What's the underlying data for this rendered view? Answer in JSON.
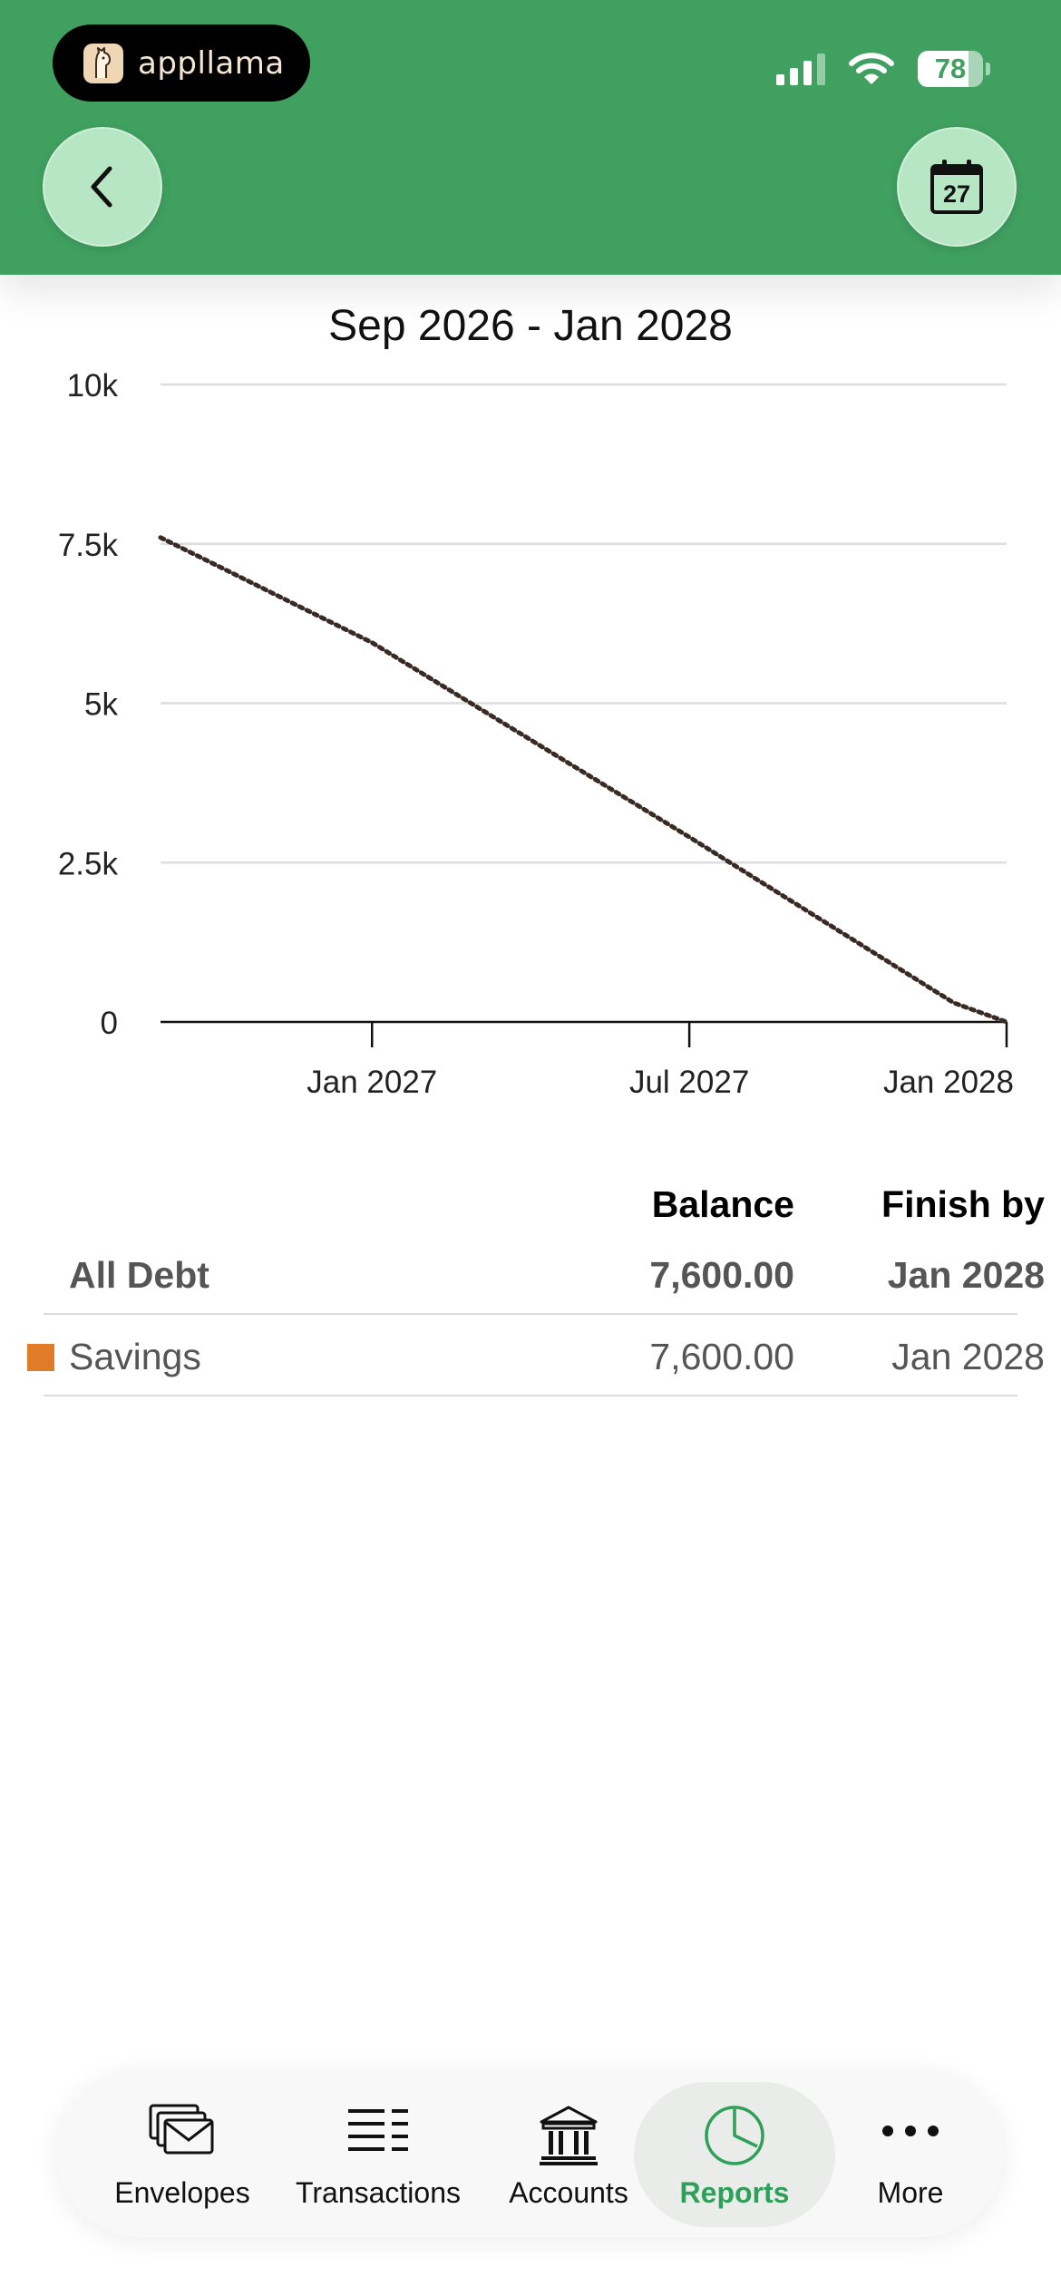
{
  "status_bar": {
    "app_name": "appllama",
    "battery_level": "78",
    "battery_fraction": 0.78
  },
  "header": {
    "back_icon": "chevron-left-icon",
    "calendar_day": "27"
  },
  "colors": {
    "header_green": "#40a060",
    "button_mint": "#b6e6c4",
    "active_tab_green": "#2fa05a",
    "savings_swatch": "#e07c28",
    "line_color": "#3a2a24"
  },
  "chart_data": {
    "type": "line",
    "title": "Sep 2026 - Jan 2028",
    "xlabel": "",
    "ylabel": "",
    "x_range": [
      "2026-09",
      "2028-01"
    ],
    "x_ticks": [
      {
        "date": "2027-01",
        "label": "Jan 2027"
      },
      {
        "date": "2027-07",
        "label": "Jul 2027"
      },
      {
        "date": "2028-01",
        "label": "Jan 2028"
      }
    ],
    "ylim": [
      0,
      10000
    ],
    "y_ticks": [
      {
        "value": 0,
        "label": "0"
      },
      {
        "value": 2500,
        "label": "2.5k"
      },
      {
        "value": 5000,
        "label": "5k"
      },
      {
        "value": 7500,
        "label": "7.5k"
      },
      {
        "value": 10000,
        "label": "10k"
      }
    ],
    "grid": true,
    "line_style": "dotted",
    "series": [
      {
        "points": [
          {
            "x": "2026-09",
            "y": 7600
          },
          {
            "x": "2027-01",
            "y": 5950
          },
          {
            "x": "2027-07",
            "y": 2900
          },
          {
            "x": "2027-12",
            "y": 300
          },
          {
            "x": "2028-01",
            "y": 0
          }
        ]
      }
    ]
  },
  "table": {
    "headers": {
      "balance": "Balance",
      "finish_by": "Finish by"
    },
    "total": {
      "name": "All Debt",
      "balance": "7,600.00",
      "finish_by": "Jan 2028"
    },
    "rows": [
      {
        "name": "Savings",
        "balance": "7,600.00",
        "finish_by": "Jan 2028"
      }
    ]
  },
  "tabs": [
    {
      "label": "Envelopes",
      "icon": "envelopes-icon"
    },
    {
      "label": "Transactions",
      "icon": "transactions-list-icon"
    },
    {
      "label": "Accounts",
      "icon": "bank-icon"
    },
    {
      "label": "Reports",
      "icon": "pie-chart-icon",
      "active": true
    },
    {
      "label": "More",
      "icon": "more-dots-icon"
    }
  ]
}
